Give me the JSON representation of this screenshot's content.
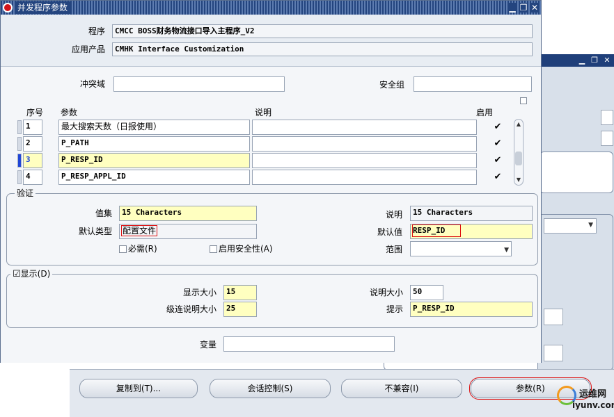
{
  "window": {
    "title": "并发程序参数"
  },
  "header": {
    "program_label": "程序",
    "program_value": "CMCC BOSS财务物流接口导入主程序_V2",
    "app_label": "应用产品",
    "app_value": "CMHK Interface Customization"
  },
  "conflict": {
    "label": "冲突域",
    "value": ""
  },
  "security_group": {
    "label": "安全组",
    "value": ""
  },
  "table": {
    "headers": {
      "seq": "序号",
      "param": "参数",
      "desc": "说明",
      "enabled": "启用"
    },
    "rows": [
      {
        "seq": "1",
        "param": "最大搜索天数（日报使用）",
        "desc": "",
        "enabled": true
      },
      {
        "seq": "2",
        "param": "P_PATH",
        "desc": "",
        "enabled": true
      },
      {
        "seq": "3",
        "param": "P_RESP_ID",
        "desc": "",
        "enabled": true
      },
      {
        "seq": "4",
        "param": "P_RESP_APPL_ID",
        "desc": "",
        "enabled": true
      }
    ]
  },
  "validation": {
    "group_label": "验证",
    "value_set_label": "值集",
    "value_set": "15 Characters",
    "desc_label": "说明",
    "desc": "15 Characters",
    "default_type_label": "默认类型",
    "default_type": "配置文件",
    "default_value_label": "默认值",
    "default_value": "RESP_ID",
    "required_label": "必需(R)",
    "enable_security_label": "启用安全性(A)",
    "range_label": "范围",
    "range_value": ""
  },
  "display": {
    "group_label": "显示(D)",
    "display_size_label": "显示大小",
    "display_size": "15",
    "desc_size_label": "说明大小",
    "desc_size": "50",
    "concat_desc_size_label": "级连说明大小",
    "concat_desc_size": "25",
    "prompt_label": "提示",
    "prompt": "P_RESP_ID"
  },
  "token": {
    "label": "变量",
    "value": ""
  },
  "buttons": {
    "copy_to": "复制到(T)...",
    "session_control": "会话控制(S)",
    "incompatible": "不兼容(I)",
    "parameters": "参数(R)"
  },
  "watermark": {
    "brand": "运维网",
    "url": "iyunv.com"
  },
  "colors": {
    "title_bar": "#24457f",
    "required_yellow": "#ffffc0",
    "highlight_red": "#d11111",
    "row_indicator": "#2046d6"
  }
}
